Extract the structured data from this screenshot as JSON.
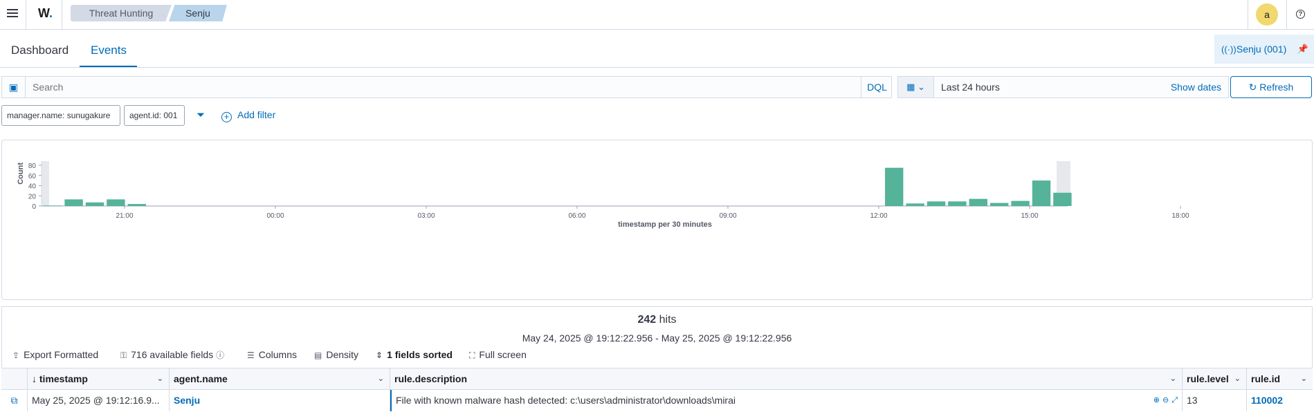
{
  "header": {
    "logo_text": "W",
    "logo_dot": ".",
    "breadcrumbs": [
      "Threat Hunting",
      "Senju"
    ],
    "avatar_letter": "a",
    "help_glyph": "?"
  },
  "tabs": [
    {
      "label": "Dashboard",
      "active": false
    },
    {
      "label": "Events",
      "active": true
    }
  ],
  "agent_pill": {
    "label": "Senju (001)"
  },
  "search": {
    "placeholder": "Search",
    "language": "DQL",
    "date_range": "Last 24 hours",
    "show_dates": "Show dates",
    "refresh": "Refresh"
  },
  "filters": {
    "chips": [
      "manager.name: sunugakure",
      "agent.id: 001"
    ],
    "add_filter": "Add filter"
  },
  "chart_data": {
    "type": "bar",
    "ylabel": "Count",
    "xlabel": "timestamp per 30 minutes",
    "ylim": [
      0,
      80
    ],
    "yticks": [
      0,
      20,
      40,
      60,
      80
    ],
    "xtick_labels": [
      "21:00",
      "00:00",
      "03:00",
      "06:00",
      "09:00",
      "12:00",
      "15:00",
      "18:00"
    ],
    "bars": [
      {
        "slot": 0,
        "value": 1
      },
      {
        "slot": 1,
        "value": 13
      },
      {
        "slot": 2,
        "value": 7
      },
      {
        "slot": 3,
        "value": 13
      },
      {
        "slot": 4,
        "value": 4
      },
      {
        "slot": 40,
        "value": 75
      },
      {
        "slot": 41,
        "value": 5
      },
      {
        "slot": 42,
        "value": 9
      },
      {
        "slot": 43,
        "value": 9
      },
      {
        "slot": 44,
        "value": 14
      },
      {
        "slot": 45,
        "value": 6
      },
      {
        "slot": 46,
        "value": 10
      },
      {
        "slot": 47,
        "value": 50
      },
      {
        "slot": 48,
        "value": 26
      }
    ],
    "color": "#54b399",
    "grid": false
  },
  "results": {
    "hits_count": "242",
    "hits_label": "hits",
    "range": "May 24, 2025 @ 19:12:22.956 - May 25, 2025 @ 19:12:22.956",
    "toolbar": {
      "export": "Export Formatted",
      "fields": "716 available fields",
      "columns": "Columns",
      "density": "Density",
      "sorted": "1 fields sorted",
      "fullscreen": "Full screen"
    }
  },
  "table": {
    "columns": [
      "timestamp",
      "agent.name",
      "rule.description",
      "rule.level",
      "rule.id"
    ],
    "rows": [
      {
        "timestamp": "May 25, 2025 @ 19:12:16.9...",
        "agent_name": "Senju",
        "rule_description": "File with known malware hash detected: c:\\users\\administrator\\downloads\\mirai",
        "rule_level": "13",
        "rule_id": "110002"
      }
    ]
  },
  "colors": {
    "accent": "#006bb8",
    "bar": "#54b399"
  }
}
